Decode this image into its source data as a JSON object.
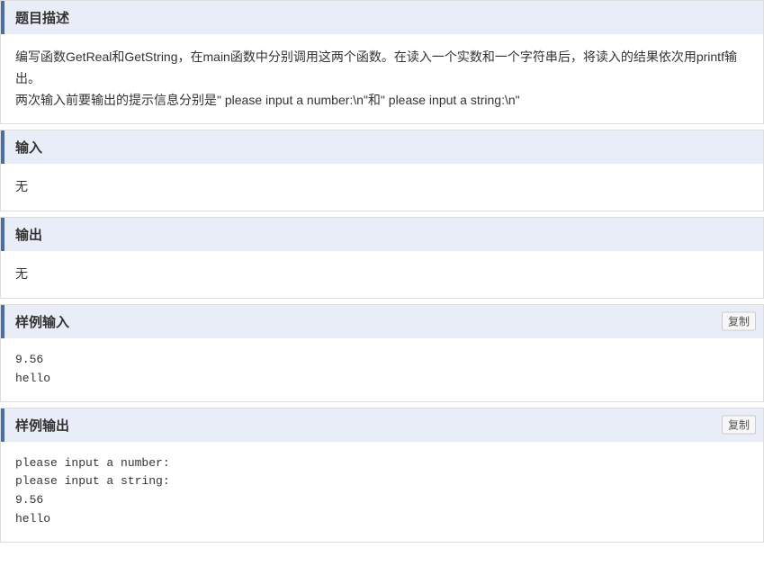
{
  "sections": {
    "description": {
      "title": "题目描述",
      "content_line1": "编写函数GetReal和GetString，在main函数中分别调用这两个函数。在读入一个实数和一个字符串后，将读入的结果依次用printf输出。",
      "content_line2": "两次输入前要输出的提示信息分别是\" please  input  a  number:\\n\"和\" please  input  a  string:\\n\""
    },
    "input": {
      "title": "输入",
      "content": "无"
    },
    "output": {
      "title": "输出",
      "content": "无"
    },
    "sample_input": {
      "title": "样例输入",
      "copy_label": "复制",
      "content": "9.56\nhello"
    },
    "sample_output": {
      "title": "样例输出",
      "copy_label": "复制",
      "content": "please input a number:\nplease input a string:\n9.56\nhello"
    }
  }
}
